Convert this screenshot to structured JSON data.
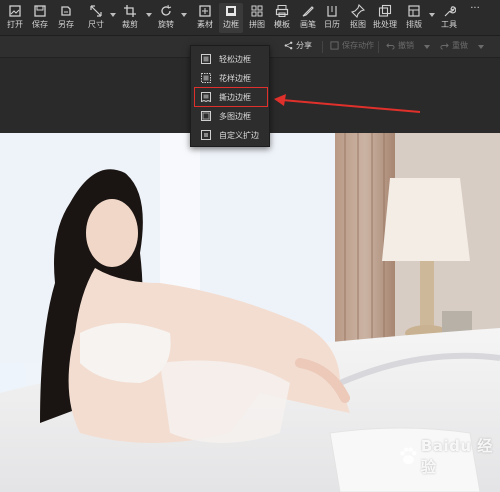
{
  "toolbar": {
    "open": "打开",
    "save": "保存",
    "save_as": "另存",
    "size": "尺寸",
    "crop": "裁剪",
    "rotate": "旋转",
    "material": "素材",
    "border": "边框",
    "puzzle": "拼图",
    "template": "模板",
    "draw": "画笔",
    "calendar": "日历",
    "cutout": "抠图",
    "batch": "批处理",
    "layout": "排版",
    "tools": "工具",
    "more": "···"
  },
  "subbar": {
    "share": "分享",
    "save_action": "保存动作",
    "undo": "撤销",
    "redo": "重做"
  },
  "border_menu": {
    "items": [
      "轻松边框",
      "花样边框",
      "撕边边框",
      "多图边框",
      "自定义扩边"
    ],
    "highlighted_index": 2
  },
  "annotation": {
    "arrow_color": "#e0302b"
  },
  "watermark": {
    "text": "Baidu 经验"
  },
  "colors": {
    "toolbar_bg": "#2b2b2b",
    "menu_bg": "#2d2d2d",
    "highlight": "#e0302b"
  }
}
